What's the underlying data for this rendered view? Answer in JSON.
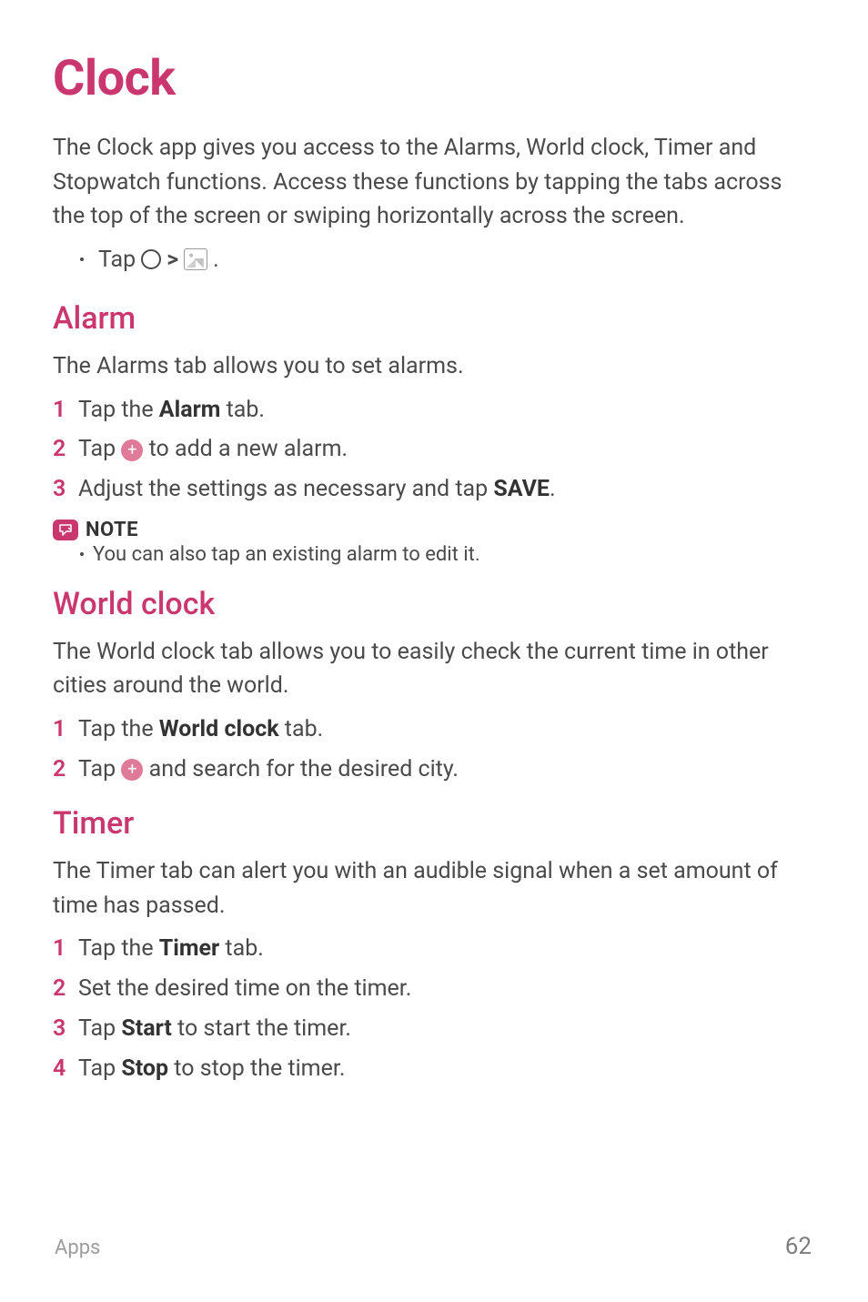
{
  "page": {
    "title": "Clock",
    "intro": "The Clock app gives you access to the Alarms, World clock, Timer and Stopwatch functions. Access these functions by tapping the tabs across the top of the screen or swiping horizontally across the screen.",
    "nav_prefix": "Tap",
    "nav_chevron": ">",
    "nav_period": "."
  },
  "sections": {
    "alarm": {
      "heading": "Alarm",
      "intro": "The Alarms tab allows you to set alarms.",
      "steps": [
        {
          "num": "1",
          "before": "Tap the ",
          "bold": "Alarm",
          "after": " tab."
        },
        {
          "num": "2",
          "before": "Tap ",
          "icon": "plus",
          "after": " to add a new alarm."
        },
        {
          "num": "3",
          "before": "Adjust the settings as necessary and tap ",
          "bold": "SAVE",
          "after": "."
        }
      ],
      "note_label": "NOTE",
      "note_text": "You can also tap an existing alarm to edit it."
    },
    "world": {
      "heading": "World clock",
      "intro": "The World clock tab allows you to easily check the current time in other cities around the world.",
      "steps": [
        {
          "num": "1",
          "before": "Tap the ",
          "bold": "World clock",
          "after": " tab."
        },
        {
          "num": "2",
          "before": "Tap ",
          "icon": "plus",
          "after": " and search for the desired city."
        }
      ]
    },
    "timer": {
      "heading": "Timer",
      "intro": "The Timer tab can alert you with an audible signal when a set amount of time has passed.",
      "steps": [
        {
          "num": "1",
          "before": "Tap the ",
          "bold": "Timer",
          "after": " tab."
        },
        {
          "num": "2",
          "before": "Set the desired time on the timer.",
          "bold": "",
          "after": ""
        },
        {
          "num": "3",
          "before": "Tap ",
          "bold": "Start",
          "after": " to start the timer."
        },
        {
          "num": "4",
          "before": "Tap ",
          "bold": "Stop",
          "after": " to stop the timer."
        }
      ]
    }
  },
  "footer": {
    "section": "Apps",
    "page_number": "62"
  }
}
